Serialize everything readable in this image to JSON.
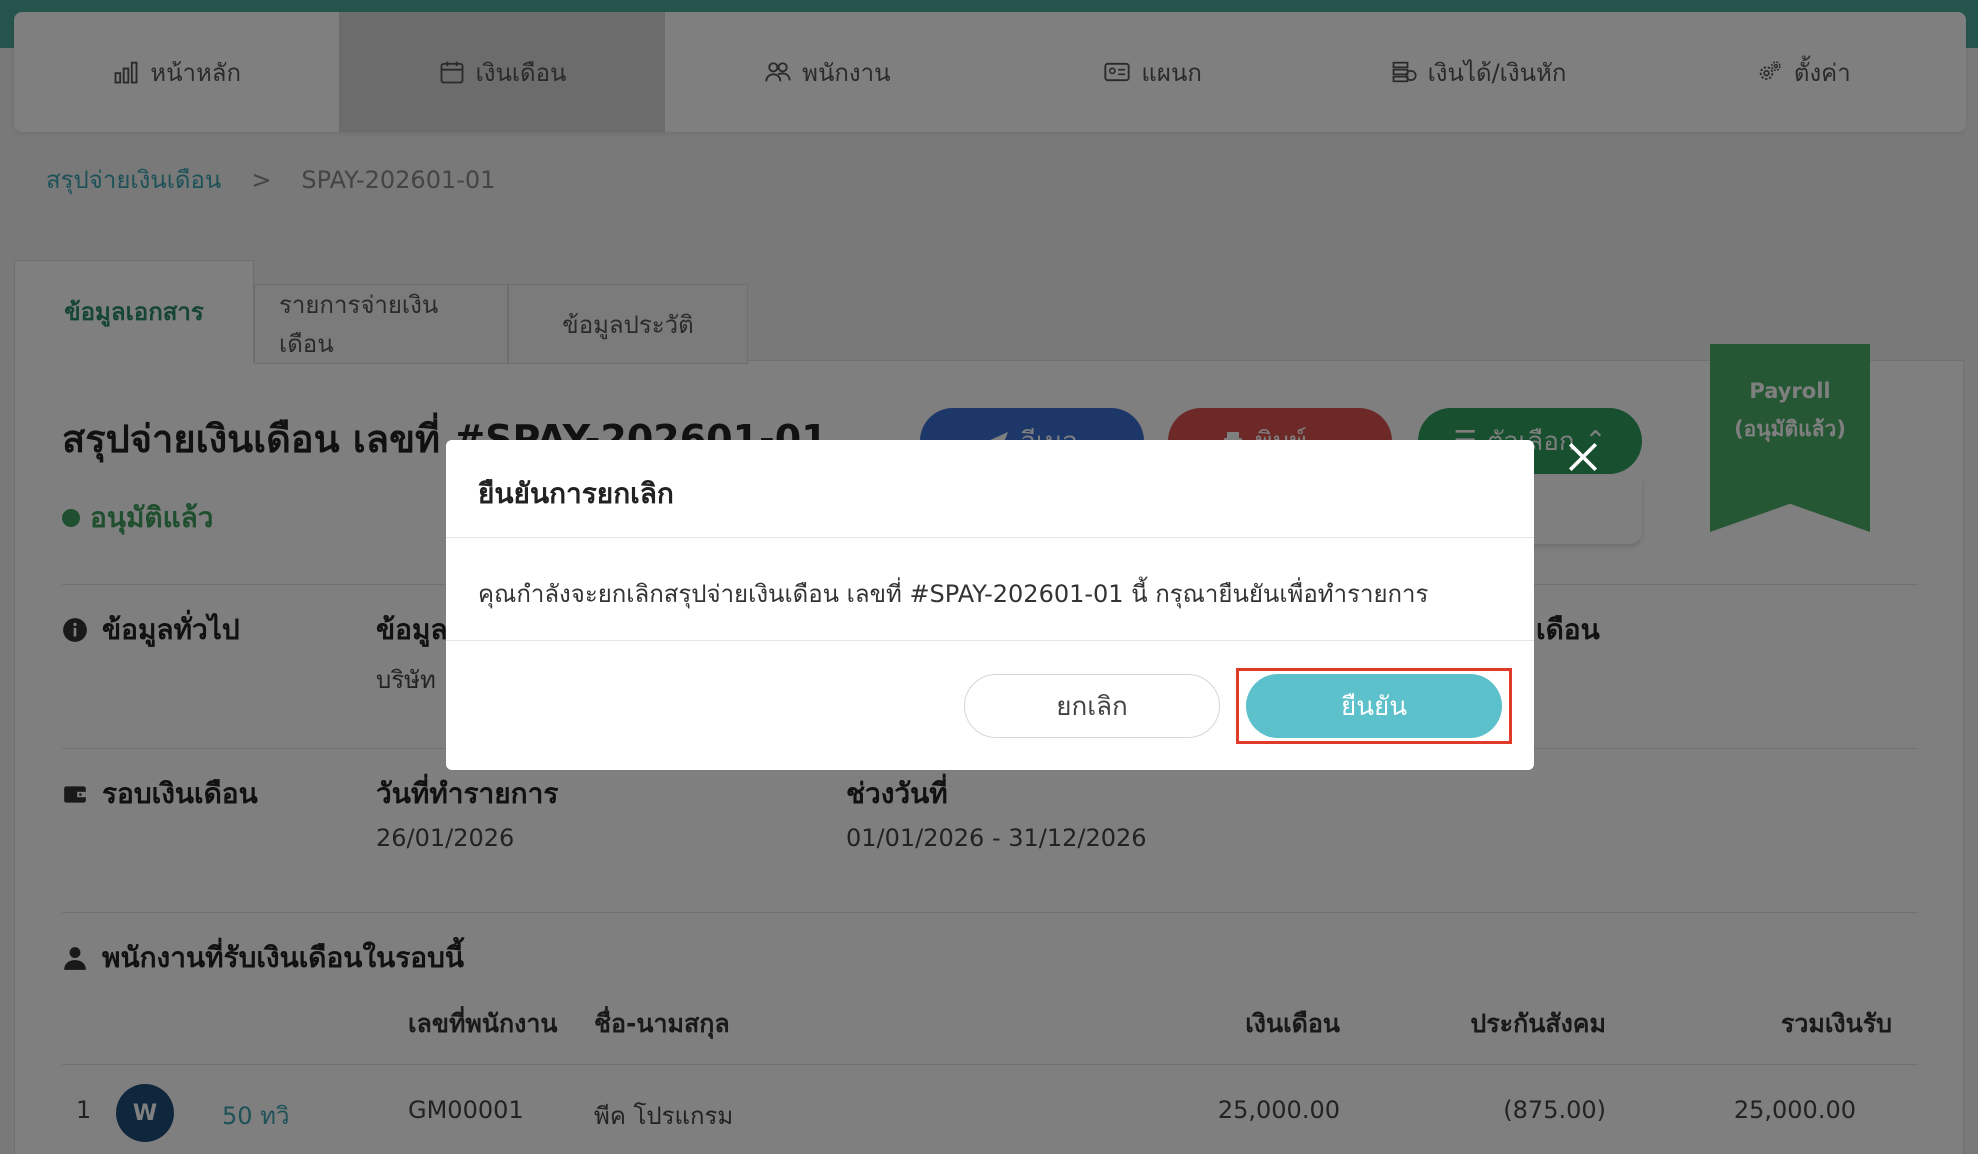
{
  "nav": {
    "items": [
      {
        "label": "หน้าหลัก",
        "icon": "bar-chart-icon"
      },
      {
        "label": "เงินเดือน",
        "icon": "calendar-icon"
      },
      {
        "label": "พนักงาน",
        "icon": "people-icon"
      },
      {
        "label": "แผนก",
        "icon": "id-card-icon"
      },
      {
        "label": "เงินได้/เงินหัก",
        "icon": "money-stack-icon"
      },
      {
        "label": "ตั้งค่า",
        "icon": "gears-icon"
      }
    ],
    "active_index": 1
  },
  "breadcrumb": {
    "link": "สรุปจ่ายเงินเดือน",
    "separator": ">",
    "current": "SPAY-202601-01"
  },
  "tabs": [
    {
      "label": "ข้อมูลเอกสาร"
    },
    {
      "label": "รายการจ่ายเงินเดือน"
    },
    {
      "label": "ข้อมูลประวัติ"
    }
  ],
  "document": {
    "title": "สรุปจ่ายเงินเดือน เลขที่ #SPAY-202601-01",
    "status": "อนุมัติแล้ว",
    "ribbon_line1": "Payroll",
    "ribbon_line2": "(อนุมัติแล้ว)"
  },
  "actions": {
    "email": "อีเมล",
    "print": "พิมพ์",
    "options": "ตัวเลือก"
  },
  "sections": {
    "general": {
      "label": "ข้อมูลทั่วไป",
      "field_label_partial": "ข้อมูล",
      "field_value_partial": "บริษัท",
      "right_label_partial": "เดือน"
    },
    "cycle": {
      "label": "รอบเงินเดือน",
      "date_label": "วันที่ทำรายการ",
      "date_value": "26/01/2026",
      "range_label": "ช่วงวันที่",
      "range_value": "01/01/2026 - 31/12/2026"
    },
    "employees": {
      "label": "พนักงานที่รับเงินเดือนในรอบนี้",
      "columns": [
        "เลขที่พนักงาน",
        "ชื่อ-นามสกุล",
        "เงินเดือน",
        "ประกันสังคม",
        "รวมเงินรับ"
      ],
      "rows": [
        {
          "no": "1",
          "avatar": "W",
          "age": "50 ทวิ",
          "emp_id": "GM00001",
          "name": "พีค โปรแกรม",
          "salary": "25,000.00",
          "social": "(875.00)",
          "total": "25,000.00"
        }
      ]
    }
  },
  "modal": {
    "title": "ยืนยันการยกเลิก",
    "message": "คุณกำลังจะยกเลิกสรุปจ่ายเงินเดือน เลขที่ #SPAY-202601-01 นี้ กรุณายืนยันเพื่อทำรายการ",
    "cancel_label": "ยกเลิก",
    "confirm_label": "ยืนยัน"
  },
  "colors": {
    "accent": "#5cc1cb",
    "highlight_frame": "#e03a2a",
    "approved": "#3e9e5e"
  }
}
